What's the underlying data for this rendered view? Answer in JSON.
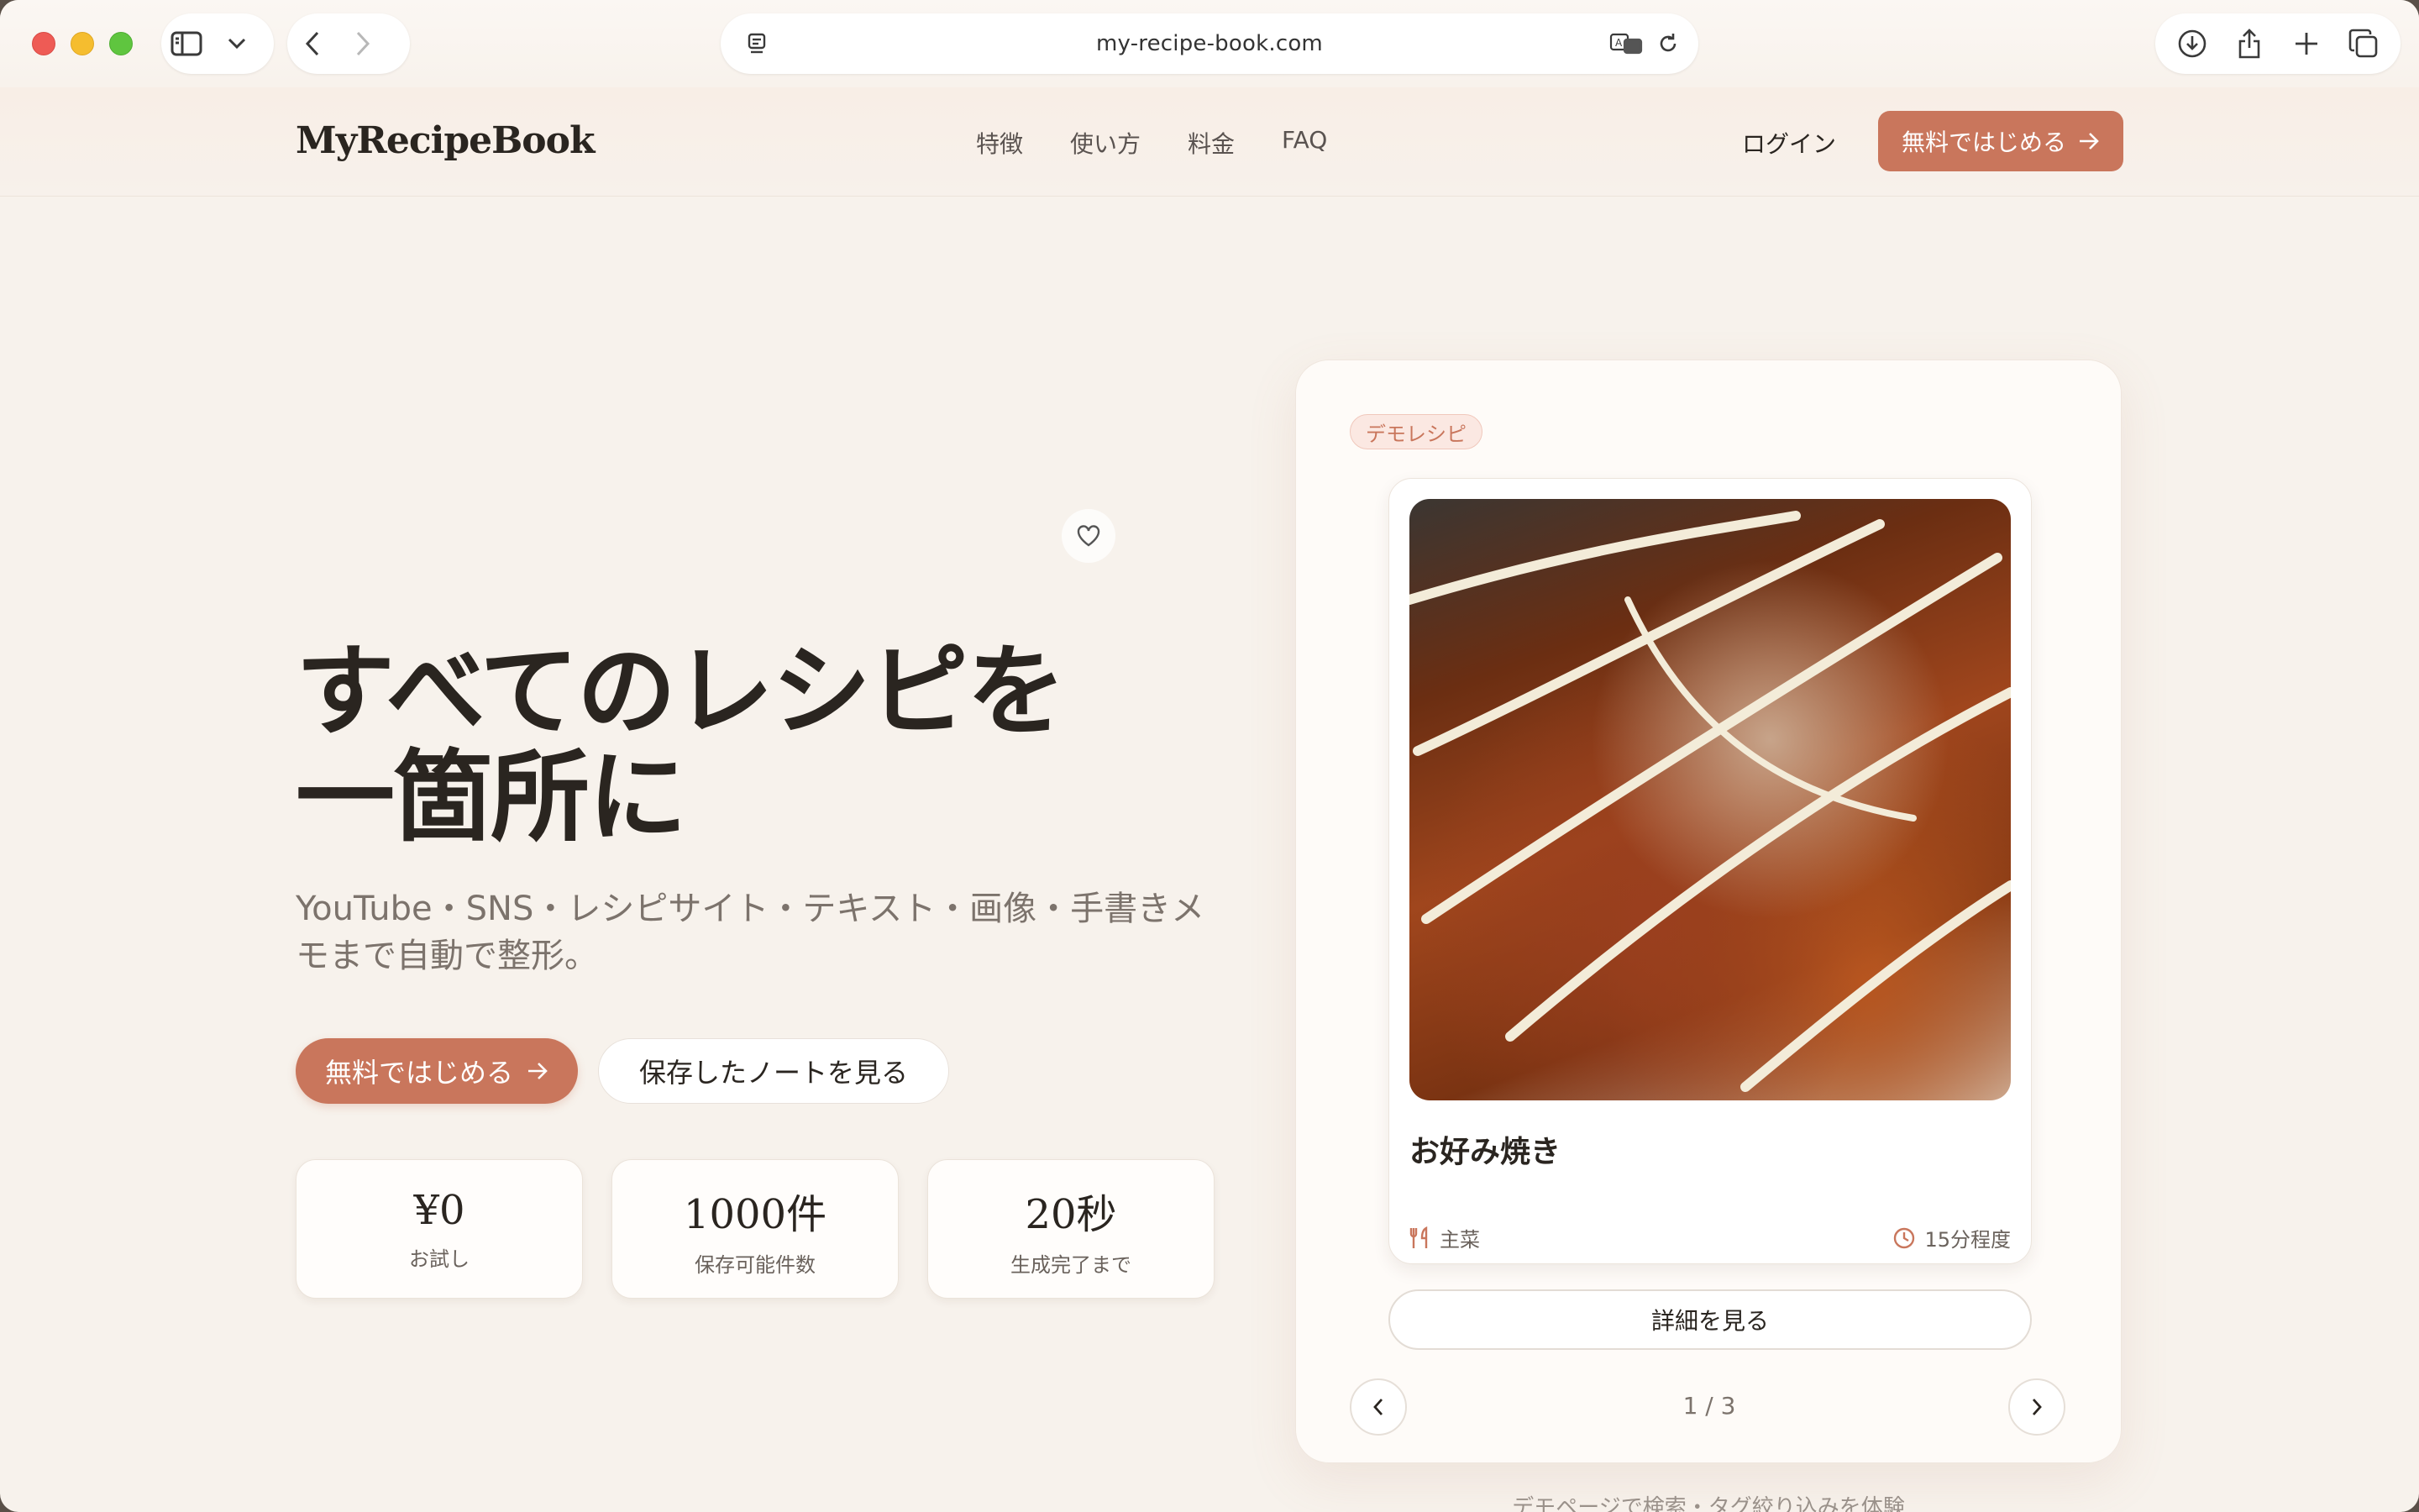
{
  "browser": {
    "url": "my-recipe-book.com"
  },
  "header": {
    "logo": "MyRecipeBook",
    "nav": [
      "特徴",
      "使い方",
      "料金",
      "FAQ"
    ],
    "login": "ログイン",
    "cta": "無料ではじめる"
  },
  "hero": {
    "title_line1": "すべてのレシピを",
    "title_line2": "一箇所に",
    "subtitle": "YouTube・SNS・レシピサイト・テキスト・画像・手書きメモまで自動で整形。",
    "primary_button": "無料ではじめる",
    "secondary_button": "保存したノートを見る",
    "stats": [
      {
        "value": "¥0",
        "label": "お試し"
      },
      {
        "value": "1000件",
        "label": "保存可能件数"
      },
      {
        "value": "20秒",
        "label": "生成完了まで"
      }
    ]
  },
  "demo": {
    "badge": "デモレシピ",
    "recipe_name": "お好み焼き",
    "category": "主菜",
    "time": "15分程度",
    "detail_button": "詳細を見る",
    "pager": "1 / 3",
    "note": "デモページで検索・タグ絞り込みを体験"
  },
  "colors": {
    "accent": "#c9765c",
    "background": "#f7f2ec",
    "text": "#2a2520"
  }
}
